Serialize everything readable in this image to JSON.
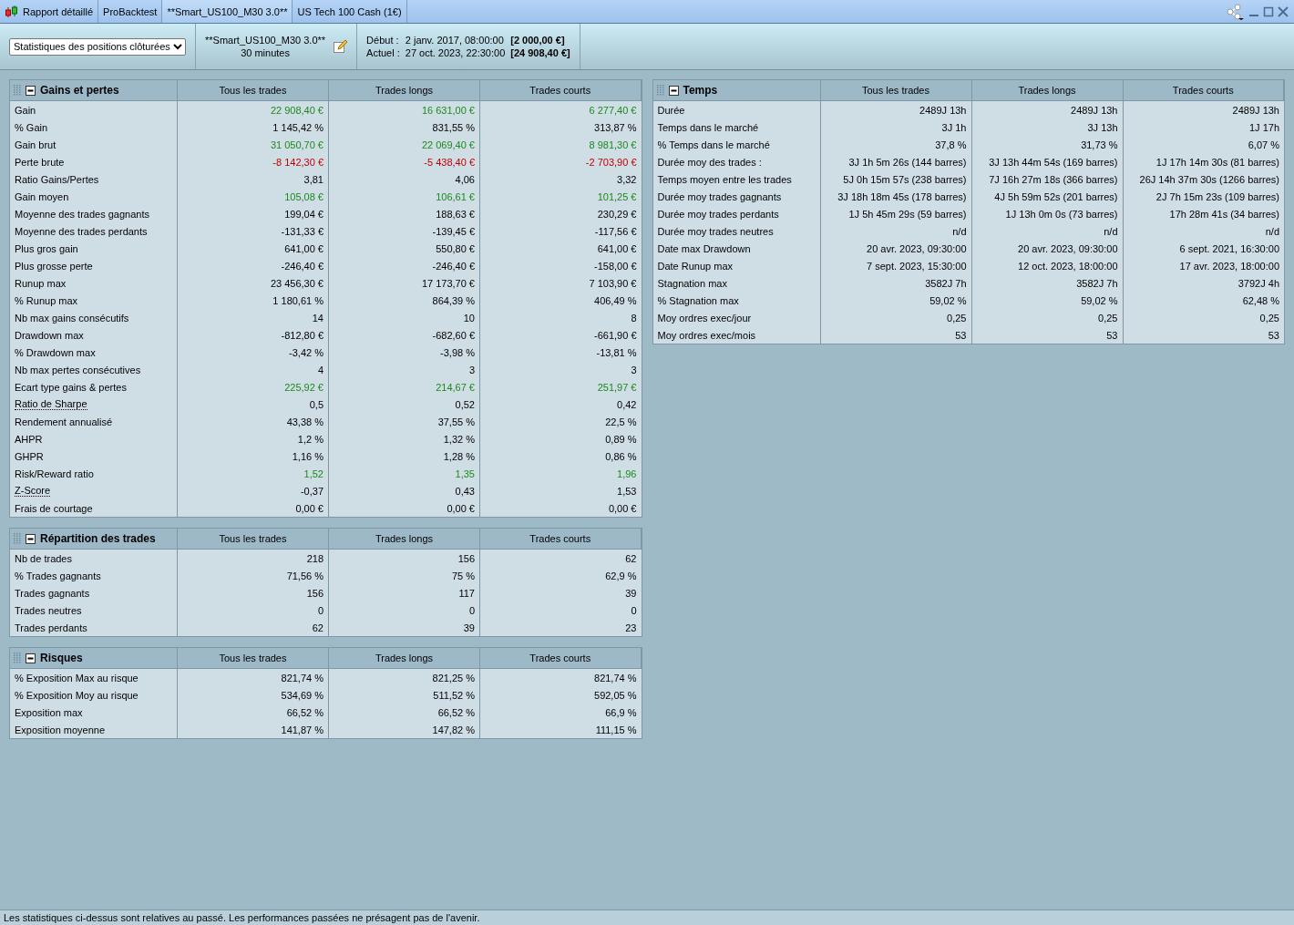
{
  "tabs": [
    {
      "label": "Rapport détaillé",
      "selected": false
    },
    {
      "label": "ProBacktest",
      "selected": false
    },
    {
      "label": "**Smart_US100_M30 3.0**",
      "selected": true
    },
    {
      "label": "US Tech 100 Cash (1€)",
      "selected": false
    }
  ],
  "toolbar": {
    "view_select": "Statistiques des positions clôturées",
    "strategy": "**Smart_US100_M30 3.0**",
    "timeframe": "30 minutes",
    "start_label": "Début :",
    "start_date": "2 janv. 2017, 08:00:00",
    "start_capital": "[2 000,00 €]",
    "current_label": "Actuel :",
    "current_date": "27 oct. 2023, 22:30:00",
    "current_capital": "[24 908,40 €]"
  },
  "left_panels": [
    {
      "title": "Gains et pertes",
      "expanded": true,
      "columns": [
        "Tous les trades",
        "Trades longs",
        "Trades courts"
      ],
      "rows": [
        {
          "label": "Gain",
          "color": "#1c8a1c",
          "values": [
            "22 908,40 €",
            "16 631,00 €",
            "6 277,40 €"
          ]
        },
        {
          "label": "% Gain",
          "values": [
            "1 145,42 %",
            "831,55 %",
            "313,87 %"
          ]
        },
        {
          "label": "Gain brut",
          "color": "#1c8a1c",
          "values": [
            "31 050,70 €",
            "22 069,40 €",
            "8 981,30 €"
          ]
        },
        {
          "label": "Perte brute",
          "color": "#c00000",
          "values": [
            "-8 142,30 €",
            "-5 438,40 €",
            "-2 703,90 €"
          ]
        },
        {
          "label": "Ratio Gains/Pertes",
          "values": [
            "3,81",
            "4,06",
            "3,32"
          ]
        },
        {
          "label": "Gain moyen",
          "color": "#1c8a1c",
          "values": [
            "105,08 €",
            "106,61 €",
            "101,25 €"
          ]
        },
        {
          "label": "Moyenne des trades gagnants",
          "values": [
            "199,04 €",
            "188,63 €",
            "230,29 €"
          ]
        },
        {
          "label": "Moyenne des trades perdants",
          "values": [
            "-131,33 €",
            "-139,45 €",
            "-117,56 €"
          ]
        },
        {
          "label": "Plus gros gain",
          "values": [
            "641,00 €",
            "550,80 €",
            "641,00 €"
          ]
        },
        {
          "label": "Plus grosse perte",
          "values": [
            "-246,40 €",
            "-246,40 €",
            "-158,00 €"
          ]
        },
        {
          "label": "Runup max",
          "values": [
            "23 456,30 €",
            "17 173,70 €",
            "7 103,90 €"
          ]
        },
        {
          "label": "% Runup max",
          "values": [
            "1 180,61 %",
            "864,39 %",
            "406,49 %"
          ]
        },
        {
          "label": "Nb max gains consécutifs",
          "values": [
            "14",
            "10",
            "8"
          ]
        },
        {
          "label": "Drawdown max",
          "values": [
            "-812,80 €",
            "-682,60 €",
            "-661,90 €"
          ]
        },
        {
          "label": "% Drawdown max",
          "values": [
            "-3,42 %",
            "-3,98 %",
            "-13,81 %"
          ]
        },
        {
          "label": "Nb max pertes consécutives",
          "values": [
            "4",
            "3",
            "3"
          ]
        },
        {
          "label": "Ecart type gains & pertes",
          "color": "#1c8a1c",
          "values": [
            "225,92 €",
            "214,67 €",
            "251,97 €"
          ]
        },
        {
          "label": "Ratio de Sharpe",
          "tooltip": true,
          "values": [
            "0,5",
            "0,52",
            "0,42"
          ]
        },
        {
          "label": "Rendement annualisé",
          "values": [
            "43,38 %",
            "37,55 %",
            "22,5 %"
          ]
        },
        {
          "label": "AHPR",
          "values": [
            "1,2 %",
            "1,32 %",
            "0,89 %"
          ]
        },
        {
          "label": "GHPR",
          "values": [
            "1,16 %",
            "1,28 %",
            "0,86 %"
          ]
        },
        {
          "label": "Risk/Reward ratio",
          "color": "#1c8a1c",
          "values": [
            "1,52",
            "1,35",
            "1,96"
          ]
        },
        {
          "label": "Z-Score",
          "tooltip": true,
          "values": [
            "-0,37",
            "0,43",
            "1,53"
          ]
        },
        {
          "label": "Frais de courtage",
          "values": [
            "0,00 €",
            "0,00 €",
            "0,00 €"
          ]
        }
      ]
    },
    {
      "title": "Répartition des trades",
      "expanded": true,
      "columns": [
        "Tous les trades",
        "Trades longs",
        "Trades courts"
      ],
      "rows": [
        {
          "label": "Nb de trades",
          "values": [
            "218",
            "156",
            "62"
          ]
        },
        {
          "label": "% Trades gagnants",
          "values": [
            "71,56 %",
            "75 %",
            "62,9 %"
          ]
        },
        {
          "label": "Trades gagnants",
          "values": [
            "156",
            "117",
            "39"
          ]
        },
        {
          "label": "Trades neutres",
          "values": [
            "0",
            "0",
            "0"
          ]
        },
        {
          "label": "Trades perdants",
          "values": [
            "62",
            "39",
            "23"
          ]
        }
      ]
    },
    {
      "title": "Risques",
      "expanded": true,
      "columns": [
        "Tous les trades",
        "Trades longs",
        "Trades courts"
      ],
      "rows": [
        {
          "label": "% Exposition Max au risque",
          "values": [
            "821,74 %",
            "821,25 %",
            "821,74 %"
          ]
        },
        {
          "label": "% Exposition Moy au risque",
          "values": [
            "534,69 %",
            "511,52 %",
            "592,05 %"
          ]
        },
        {
          "label": "Exposition max",
          "values": [
            "66,52 %",
            "66,52 %",
            "66,9 %"
          ]
        },
        {
          "label": "Exposition moyenne",
          "values": [
            "141,87 %",
            "147,82 %",
            "111,15 %"
          ]
        }
      ]
    }
  ],
  "right_panels": [
    {
      "title": "Temps",
      "expanded": true,
      "columns": [
        "Tous les trades",
        "Trades longs",
        "Trades courts"
      ],
      "rows": [
        {
          "label": "Durée",
          "values": [
            "2489J 13h",
            "2489J 13h",
            "2489J 13h"
          ]
        },
        {
          "label": "Temps dans le marché",
          "values": [
            "3J 1h",
            "3J 13h",
            "1J 17h"
          ]
        },
        {
          "label": "% Temps dans le marché",
          "values": [
            "37,8 %",
            "31,73 %",
            "6,07 %"
          ]
        },
        {
          "label": "Durée moy des trades :",
          "values": [
            "3J 1h 5m 26s (144 barres)",
            "3J 13h 44m 54s (169 barres)",
            "1J 17h 14m 30s (81 barres)"
          ]
        },
        {
          "label": "Temps moyen entre les trades",
          "values": [
            "5J 0h 15m 57s (238 barres)",
            "7J 16h 27m 18s (366 barres)",
            "26J 14h 37m 30s (1266 barres)"
          ]
        },
        {
          "label": "Durée moy trades gagnants",
          "values": [
            "3J 18h 18m 45s (178 barres)",
            "4J 5h 59m 52s (201 barres)",
            "2J 7h 15m 23s (109 barres)"
          ]
        },
        {
          "label": "Durée moy trades perdants",
          "values": [
            "1J 5h 45m 29s (59 barres)",
            "1J 13h 0m 0s (73 barres)",
            "17h 28m 41s (34 barres)"
          ]
        },
        {
          "label": "Durée moy trades neutres",
          "values": [
            "n/d",
            "n/d",
            "n/d"
          ]
        },
        {
          "label": "Date max Drawdown",
          "values": [
            "20 avr. 2023, 09:30:00",
            "20 avr. 2023, 09:30:00",
            "6 sept. 2021, 16:30:00"
          ]
        },
        {
          "label": "Date Runup max",
          "values": [
            "7 sept. 2023, 15:30:00",
            "12 oct. 2023, 18:00:00",
            "17 avr. 2023, 18:00:00"
          ]
        },
        {
          "label": "Stagnation max",
          "values": [
            "3582J 7h",
            "3582J 7h",
            "3792J 4h"
          ]
        },
        {
          "label": "% Stagnation max",
          "values": [
            "59,02 %",
            "59,02 %",
            "62,48 %"
          ]
        },
        {
          "label": "Moy ordres exec/jour",
          "values": [
            "0,25",
            "0,25",
            "0,25"
          ]
        },
        {
          "label": "Moy ordres exec/mois",
          "values": [
            "53",
            "53",
            "53"
          ]
        }
      ]
    }
  ],
  "status_bar": "Les statistiques ci-dessus sont relatives au passé. Les performances passées ne présagent pas de l'avenir."
}
